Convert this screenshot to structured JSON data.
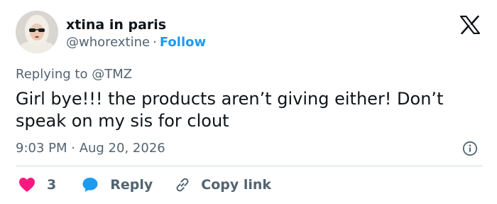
{
  "author": {
    "display_name": "xtina in paris",
    "handle": "@whorextine",
    "separator": "·",
    "follow_label": "Follow"
  },
  "reply_context": {
    "prefix": "Replying to",
    "mention": "@TMZ"
  },
  "tweet": {
    "text": "Girl bye!!! the products aren’t giving either! Don’t speak on my sis for clout",
    "timestamp": "9:03 PM · Aug 20, 2026"
  },
  "actions": {
    "like_count": "3",
    "reply_label": "Reply",
    "copy_link_label": "Copy link"
  },
  "colors": {
    "like": "#f91880",
    "reply": "#1d9bf0",
    "link": "#1d9bf0",
    "muted": "#536471"
  },
  "icons": [
    "x-logo-icon",
    "info-icon",
    "heart-icon",
    "speech-bubble-icon",
    "link-icon"
  ]
}
